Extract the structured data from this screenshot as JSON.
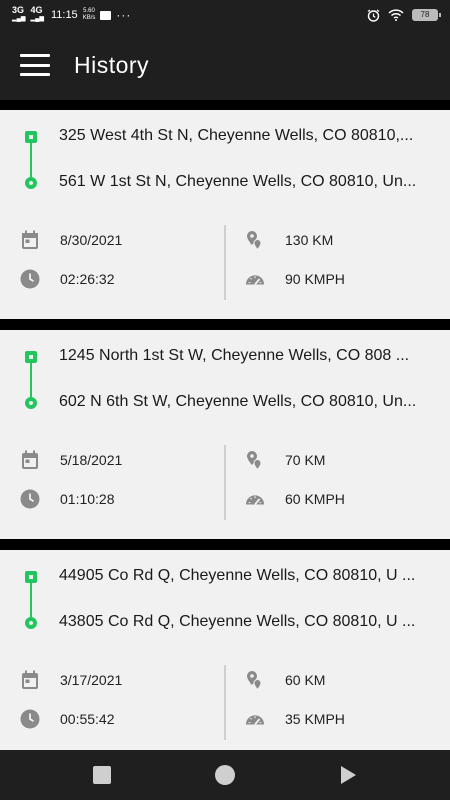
{
  "status_bar": {
    "signal_1": "3G",
    "signal_2": "4G",
    "time": "11:15",
    "net_speed_value": "5.60",
    "net_speed_unit": "KB/s",
    "more": "···",
    "battery": "78"
  },
  "app_bar": {
    "title": "History",
    "menu_icon": "hamburger-menu-icon"
  },
  "trips": [
    {
      "from": "325 West 4th St N, Cheyenne Wells, CO 80810,...",
      "to": "561 W 1st St N, Cheyenne Wells, CO 80810, Un...",
      "date": "8/30/2021",
      "duration": "02:26:32",
      "distance": "130 KM",
      "speed": "90 KMPH"
    },
    {
      "from": "1245 North 1st St W, Cheyenne Wells, CO 808 ...",
      "to": "602 N 6th St W, Cheyenne Wells, CO 80810, Un...",
      "date": "5/18/2021",
      "duration": "01:10:28",
      "distance": "70 KM",
      "speed": "60 KMPH"
    },
    {
      "from": "44905 Co Rd Q, Cheyenne Wells, CO 80810, U ...",
      "to": "43805 Co Rd Q, Cheyenne Wells, CO 80810, U ...",
      "date": "3/17/2021",
      "duration": "00:55:42",
      "distance": "60 KM",
      "speed": "35 KMPH"
    }
  ],
  "colors": {
    "accent": "#22c55e",
    "bar_background": "#1f1f1f",
    "card_background": "#f1f1f1",
    "icon_gray": "#8a8a8a"
  },
  "nav": {
    "back": "square-recents-icon",
    "home": "circle-home-icon",
    "recents": "triangle-back-icon"
  }
}
